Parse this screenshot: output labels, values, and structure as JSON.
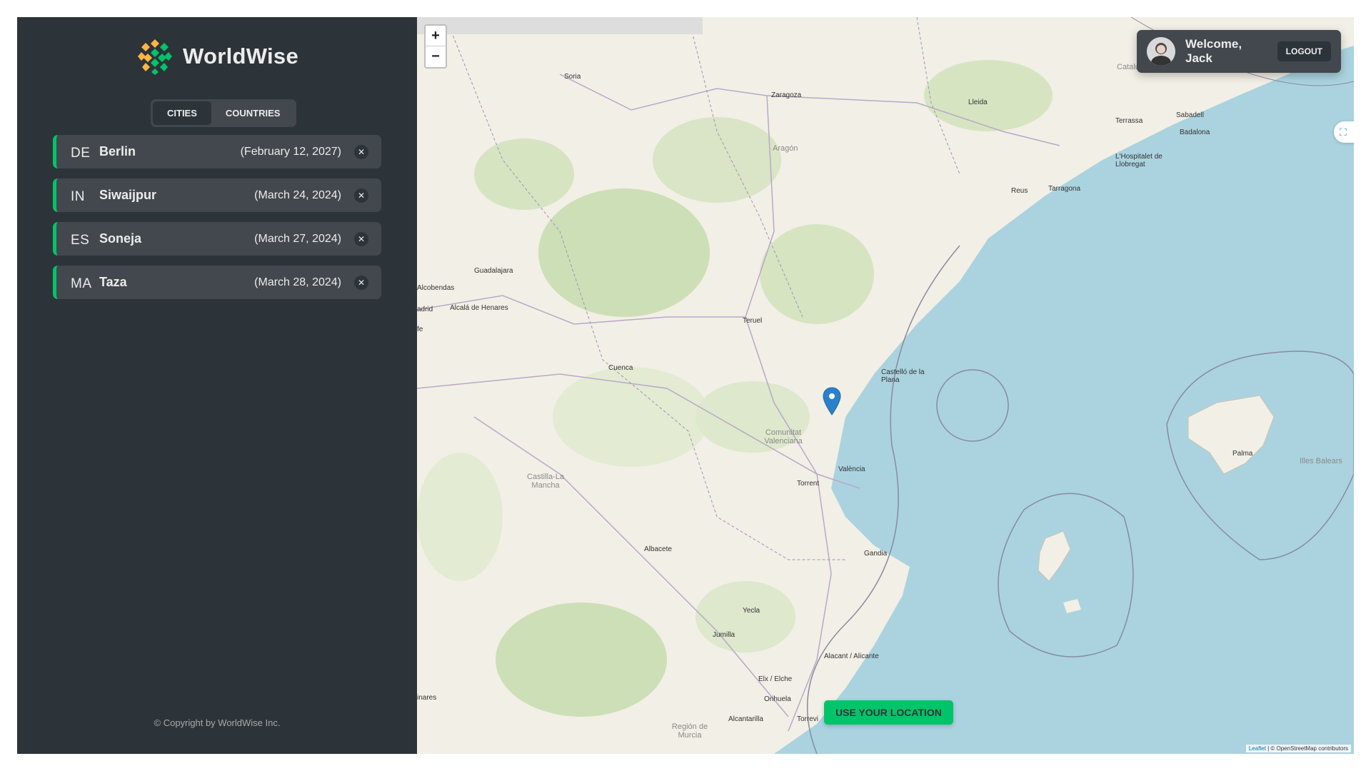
{
  "app": {
    "name": "WorldWise"
  },
  "tabs": [
    {
      "label": "Cities",
      "active": true
    },
    {
      "label": "Countries",
      "active": false
    }
  ],
  "cities": [
    {
      "code": "DE",
      "name": "Berlin",
      "date": "(February 12, 2027)"
    },
    {
      "code": "IN",
      "name": "Siwaijpur",
      "date": "(March 24, 2024)"
    },
    {
      "code": "ES",
      "name": "Soneja",
      "date": "(March 27, 2024)"
    },
    {
      "code": "MA",
      "name": "Taza",
      "date": "(March 28, 2024)"
    }
  ],
  "footer": {
    "copyright": "© Copyright by WorldWise Inc."
  },
  "map": {
    "zoom_in": "+",
    "zoom_out": "−",
    "use_location": "USE YOUR LOCATION",
    "attribution_leaflet": "Leaflet",
    "attribution_rest": "| © OpenStreetMap contributors",
    "labels": {
      "soria": "Soria",
      "zaragoza": "Zaragoza",
      "lleida": "Lleida",
      "catalunya": "Catalunya",
      "sabadell": "Sabadell",
      "terrassa": "Terrassa",
      "badalona": "Badalona",
      "hospitalet": "L'Hospitalet de Llobregat",
      "reus": "Reus",
      "tarragona": "Tarragona",
      "aragon": "Aragón",
      "guadalajara": "Guadalajara",
      "alcobendas": "Alcobendas",
      "madrid": "adrid",
      "alcala": "Alcalá de Henares",
      "fe": "fe",
      "teruel": "Teruel",
      "cuenca": "Cuenca",
      "castellon": "Castelló de la Plana",
      "comunitat": "Comunitat Valenciana",
      "valencia": "València",
      "torrent": "Torrent",
      "castilla": "Castilla-La Mancha",
      "albacete": "Albacete",
      "gandia": "Gandia",
      "palma": "Palma",
      "illes": "Illes Balears",
      "yecla": "Yecla",
      "jumilla": "Jumilla",
      "alacant": "Alacant / Alicante",
      "elx": "Elx / Elche",
      "orihuela": "Orihuela",
      "alcantarilla": "Alcantarilla",
      "torrevieja": "Torrevi",
      "murcia": "Región de Murcia",
      "linares": "inares"
    }
  },
  "user": {
    "welcome": "Welcome, Jack",
    "logout": "Logout"
  },
  "colors": {
    "brand_green": "#00c46a",
    "dark": "#2d3439",
    "medium": "#42484d",
    "sea": "#aad3df"
  }
}
